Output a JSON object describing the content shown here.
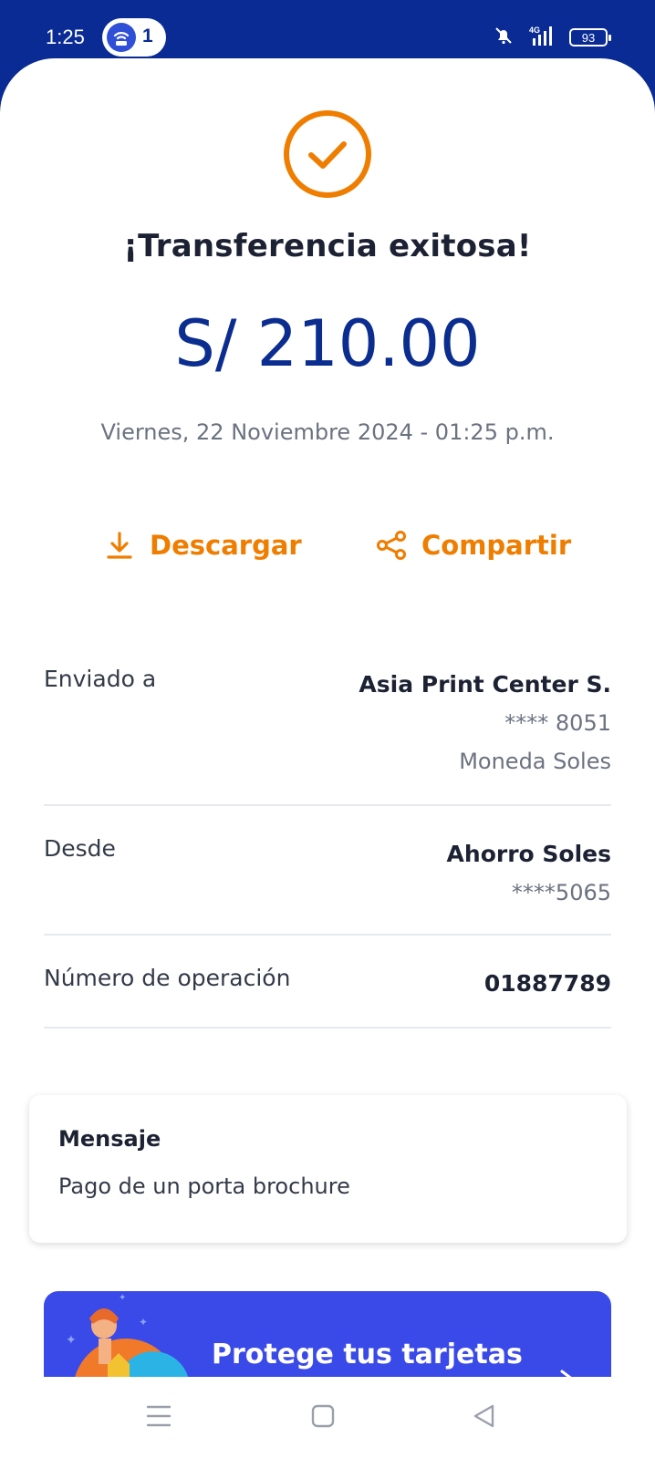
{
  "status_bar": {
    "time": "1:25",
    "notification_count": "1",
    "network": "4G",
    "battery": "93"
  },
  "receipt": {
    "title": "¡Transferencia exitosa!",
    "amount": "S/ 210.00",
    "datetime": "Viernes, 22 Noviembre 2024 - 01:25 p.m.",
    "accent_color": "#ef7d00",
    "amount_color": "#0b2d8f"
  },
  "actions": {
    "download_label": "Descargar",
    "share_label": "Compartir"
  },
  "details": {
    "sent_to": {
      "label": "Enviado a",
      "name": "Asia Print Center S.",
      "account": "**** 8051",
      "currency": "Moneda Soles"
    },
    "from": {
      "label": "Desde",
      "name": "Ahorro Soles",
      "account": "****5065"
    },
    "operation": {
      "label": "Número de operación",
      "value": "01887789"
    }
  },
  "message": {
    "title": "Mensaje",
    "body": "Pago de un porta brochure"
  },
  "promo": {
    "text": "Protege tus tarjetas",
    "background": "#3a4ae8"
  },
  "nav": {
    "icons": [
      "menu-icon",
      "home-square-icon",
      "back-triangle-icon"
    ]
  }
}
